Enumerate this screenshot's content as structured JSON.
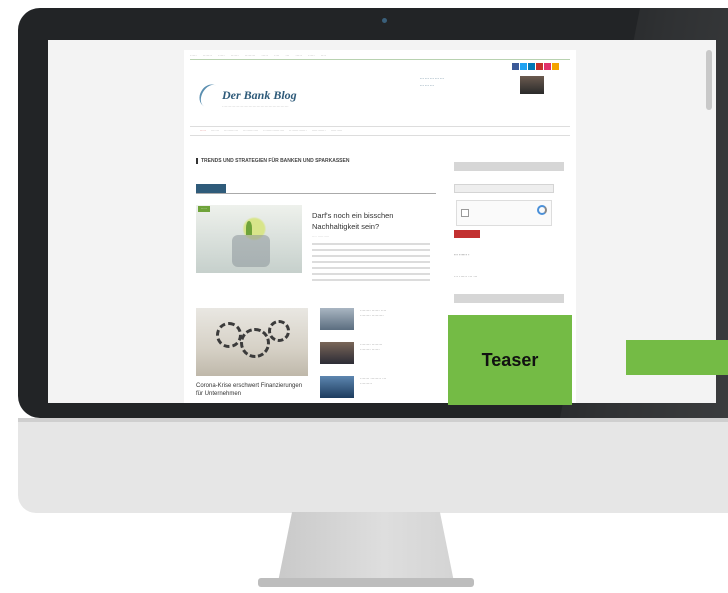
{
  "monitor": {
    "frame_color": "#222426",
    "chin_color": "#e6e6e6"
  },
  "overlay": {
    "teaser_label": "Teaser",
    "accent_color": "#74bb45"
  },
  "website": {
    "logo_title": "Der Bank Blog",
    "section_heading": "TRENDS UND STRATEGIEN FÜR BANKEN UND SPARKASSEN",
    "featured_title": "Darf's noch ein bisschen Nachhaltigkeit sein?",
    "second_post_title": "Corona-Krise erschwert Finanzierungen für Unternehmen",
    "brand_color": "#2f5b7a"
  }
}
